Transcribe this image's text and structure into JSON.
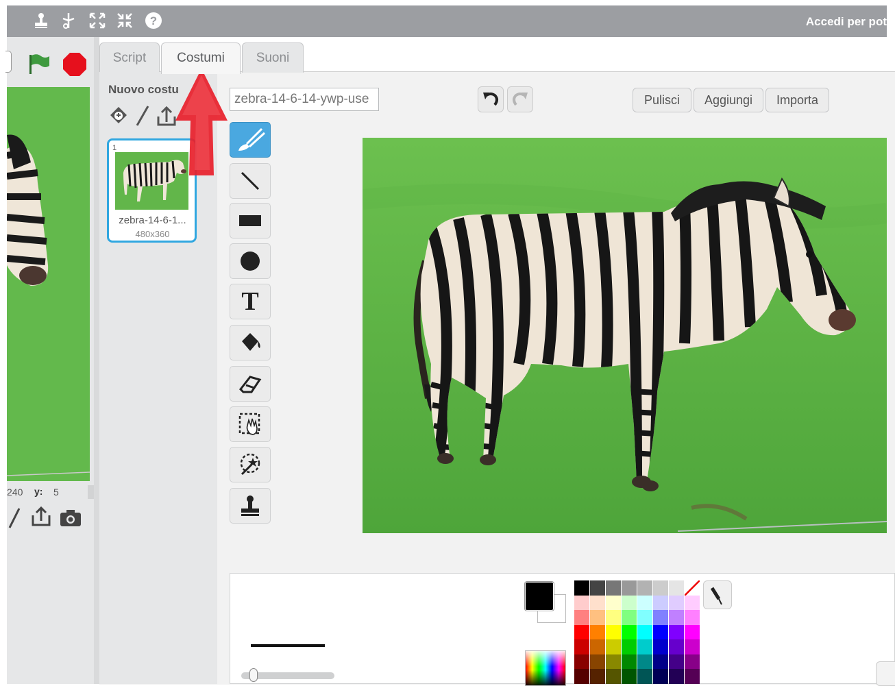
{
  "topbar": {
    "signin_text": "Accedi per pot",
    "icons": [
      "stamp-icon",
      "cut-icon",
      "grow-icon",
      "shrink-icon",
      "help-icon"
    ]
  },
  "stage": {
    "coord_x_value": "240",
    "coord_y_label": "y:",
    "coord_y_value": "5"
  },
  "tabs": [
    {
      "label": "Script",
      "active": false
    },
    {
      "label": "Costumi",
      "active": true
    },
    {
      "label": "Suoni",
      "active": false
    }
  ],
  "costumes": {
    "new_label": "Nuovo costu",
    "items": [
      {
        "number": "1",
        "name": "zebra-14-6-1...",
        "size": "480x360"
      }
    ]
  },
  "editor": {
    "costume_name": "zebra-14-6-14-ywp-use",
    "buttons": {
      "clear": "Pulisci",
      "add": "Aggiungi",
      "import": "Importa"
    },
    "tools": [
      "brush-icon",
      "line-icon",
      "rectangle-icon",
      "ellipse-icon",
      "text-icon",
      "fill-icon",
      "eraser-icon",
      "select-icon",
      "magic-select-icon",
      "stamp-icon"
    ],
    "text_tool_glyph": "T",
    "line_width_level": 0.1,
    "primary_color": "#000000",
    "secondary_color": "#ffffff"
  },
  "palette": [
    [
      "#000000",
      "#444444",
      "#777777",
      "#999999",
      "#b2b2b2",
      "#cccccc",
      "#e5e5e5",
      "#ffffff"
    ],
    [
      "#ffcccc",
      "#ffe0cc",
      "#ffffcc",
      "#ccffcc",
      "#ccffff",
      "#ccccff",
      "#e0ccff",
      "#ffccff"
    ],
    [
      "#ff8080",
      "#ffc080",
      "#ffff80",
      "#80ff80",
      "#80ffff",
      "#8080ff",
      "#c080ff",
      "#ff80ff"
    ],
    [
      "#ff0000",
      "#ff8000",
      "#ffff00",
      "#00ff00",
      "#00ffff",
      "#0000ff",
      "#8000ff",
      "#ff00ff"
    ],
    [
      "#cc0000",
      "#cc6600",
      "#cccc00",
      "#00cc00",
      "#00cccc",
      "#0000cc",
      "#6600cc",
      "#cc00cc"
    ],
    [
      "#880000",
      "#884400",
      "#888800",
      "#008800",
      "#008888",
      "#000088",
      "#440088",
      "#880088"
    ],
    [
      "#550000",
      "#552200",
      "#555500",
      "#005500",
      "#005555",
      "#000055",
      "#220055",
      "#550055"
    ]
  ]
}
